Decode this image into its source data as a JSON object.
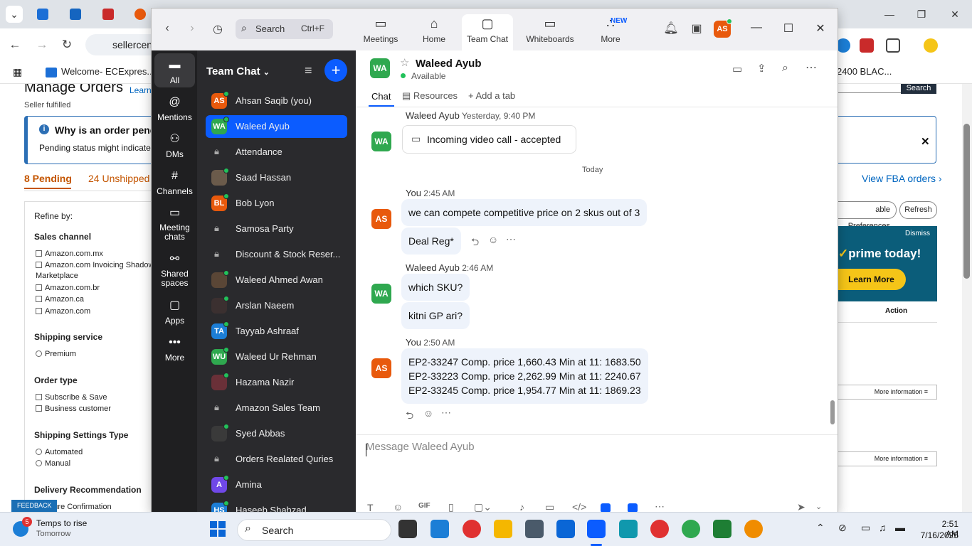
{
  "browser": {
    "url": "sellercent",
    "bookmark": "Welcome- ECExpres...",
    "partial_right": "2400 BLAC..."
  },
  "seller": {
    "title": "Manage Orders",
    "learn": "Learn",
    "fulfilled": "Seller fulfilled",
    "alert_title": "Why is an order pendi",
    "alert_body": "Pending status might indicate an",
    "tab_pending": "8 Pending",
    "tab_unshipped": "24 Unshipped",
    "view_fba": "View FBA orders ›",
    "refine": "Refine by:",
    "sales_channel": "Sales channel",
    "channels": [
      "Amazon.com.mx",
      "Amazon.com Invoicing Shadow",
      "Marketplace",
      "Amazon.com.br",
      "Amazon.ca",
      "Amazon.com"
    ],
    "shipping_service": "Shipping service",
    "premium": "Premium",
    "order_type": "Order type",
    "subscribe": "Subscribe & Save",
    "business": "Business customer",
    "shipping_settings": "Shipping Settings Type",
    "automated": "Automated",
    "manual": "Manual",
    "delivery_rec": "Delivery Recommendation",
    "signature": "nature Confirmation",
    "feedback": "FEEDBACK",
    "table_prefs": "able Preferences",
    "refresh": "Refresh",
    "search_btn": "Search",
    "action": "Action",
    "more_info": "More information ≡",
    "prime_dismiss": "Dismiss",
    "prime_text": "prime today!",
    "prime_btn": "Learn More"
  },
  "zoom": {
    "search_label": "Search",
    "search_shortcut": "Ctrl+F",
    "tabs": [
      {
        "label": "Meetings",
        "icon": "video-icon"
      },
      {
        "label": "Home",
        "icon": "home-icon"
      },
      {
        "label": "Team Chat",
        "icon": "chat-icon"
      },
      {
        "label": "Whiteboards",
        "icon": "whiteboard-icon"
      },
      {
        "label": "More",
        "icon": "more-icon"
      }
    ],
    "new_badge": "NEW",
    "user_initials": "AS",
    "rail": [
      {
        "label": "All"
      },
      {
        "label": "Mentions"
      },
      {
        "label": "DMs"
      },
      {
        "label": "Channels"
      },
      {
        "label": "Meeting chats"
      },
      {
        "label": "Shared spaces"
      },
      {
        "label": "Apps"
      },
      {
        "label": "More"
      }
    ],
    "list_title": "Team Chat",
    "channels": [
      {
        "initials": "AS",
        "name": "Ahsan Saqib (you)",
        "color": "#e8590c"
      },
      {
        "initials": "WA",
        "name": "Waleed Ayub",
        "color": "#2fa84f"
      },
      {
        "initials": "",
        "name": "Attendance",
        "color": ""
      },
      {
        "initials": "",
        "name": "Saad Hassan",
        "color": "#6b5b4b"
      },
      {
        "initials": "BL",
        "name": "Bob Lyon",
        "color": "#e8590c"
      },
      {
        "initials": "",
        "name": "Samosa Party",
        "color": ""
      },
      {
        "initials": "",
        "name": "Discount & Stock Reser...",
        "color": ""
      },
      {
        "initials": "",
        "name": "Waleed Ahmed Awan",
        "color": "#5a4636"
      },
      {
        "initials": "",
        "name": "Arslan Naeem",
        "color": "#3b3030"
      },
      {
        "initials": "TA",
        "name": "Tayyab Ashraaf",
        "color": "#1c7ed6"
      },
      {
        "initials": "WU",
        "name": "Waleed Ur Rehman",
        "color": "#2fa84f"
      },
      {
        "initials": "",
        "name": "Hazama Nazir",
        "color": "#6a3038"
      },
      {
        "initials": "",
        "name": "Amazon Sales Team",
        "color": ""
      },
      {
        "initials": "",
        "name": "Syed Abbas",
        "color": "#3a3a3a"
      },
      {
        "initials": "",
        "name": "Orders Realated Quries",
        "color": ""
      },
      {
        "initials": "A",
        "name": "Amina",
        "color": "#7048e8"
      },
      {
        "initials": "HS",
        "name": "Haseeb Shahzad",
        "color": "#1c7ed6"
      }
    ],
    "chat": {
      "contact_initials": "WA",
      "contact_name": "Waleed Ayub",
      "status": "Available",
      "tab_chat": "Chat",
      "tab_resources": "Resources",
      "tab_add": "Add a tab",
      "msg0_author": "Waleed Ayub",
      "msg0_time": "Yesterday, 9:40 PM",
      "msg0_text": "Incoming video call - accepted",
      "divider": "Today",
      "msg1_author": "You",
      "msg1_time": "2:45 AM",
      "msg1_text": "we can compete competitive price on 2 skus out of 3",
      "msg1b_text": "Deal Reg*",
      "msg2_author": "Waleed Ayub",
      "msg2_time": "2:46 AM",
      "msg2_text": "which SKU?",
      "msg2b_text": "kitni GP ari?",
      "msg3_author": "You",
      "msg3_time": "2:50 AM",
      "msg3_lines": [
        "EP2-33247 Comp. price 1,660.43 Min at 11: 1683.50",
        "EP2-33223  Comp. price 2,262.99 Min at 11: 2240.67",
        "EP2-33245 Comp. price 1,954.77 Min at 11:  1869.23"
      ],
      "composer_placeholder": "Message Waleed Ayub",
      "my_initials": "AS",
      "their_initials": "WA"
    }
  },
  "taskbar": {
    "weather_badge": "5",
    "weather_title": "Temps to rise",
    "weather_sub": "Tomorrow",
    "search": "Search",
    "time": "2:51 AM",
    "date": "7/16/2025"
  }
}
